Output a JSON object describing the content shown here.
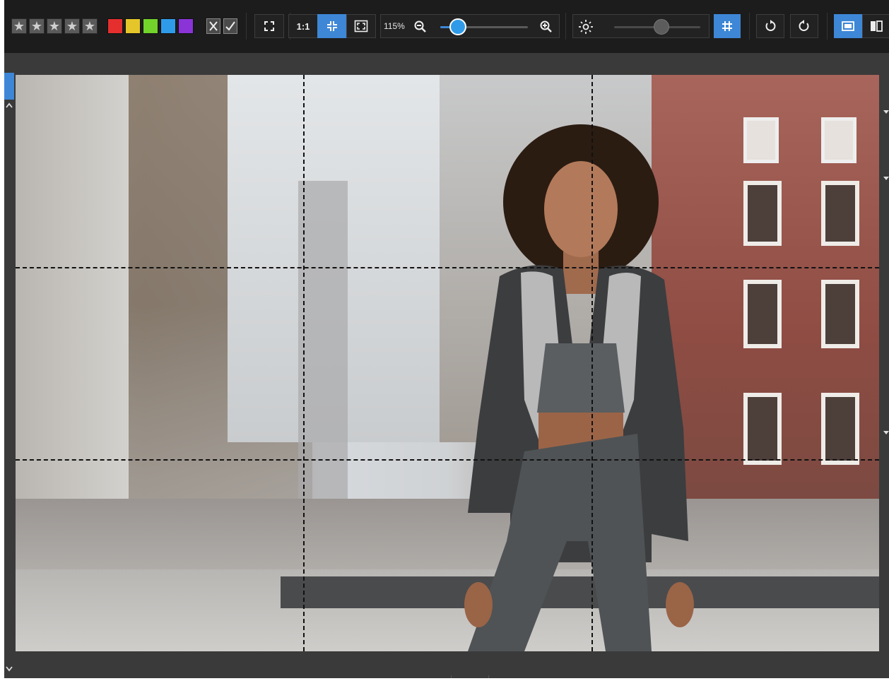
{
  "toolbar": {
    "rating_stars": [
      "★",
      "★",
      "★",
      "★",
      "★"
    ],
    "color_labels": [
      "#e52e2e",
      "#e5c62a",
      "#72d32b",
      "#2f9be8",
      "#8a34d8"
    ],
    "flags": [
      "reject-flag-icon",
      "pick-flag-icon"
    ],
    "one_to_one_label": "1:1",
    "zoom_level": "115%",
    "zoom_fraction": 0.2,
    "brightness_fraction": 0.55,
    "accent_color": "#3d87d6"
  },
  "viewer": {
    "grid_overlay": "on",
    "grid_divisions": 3
  }
}
